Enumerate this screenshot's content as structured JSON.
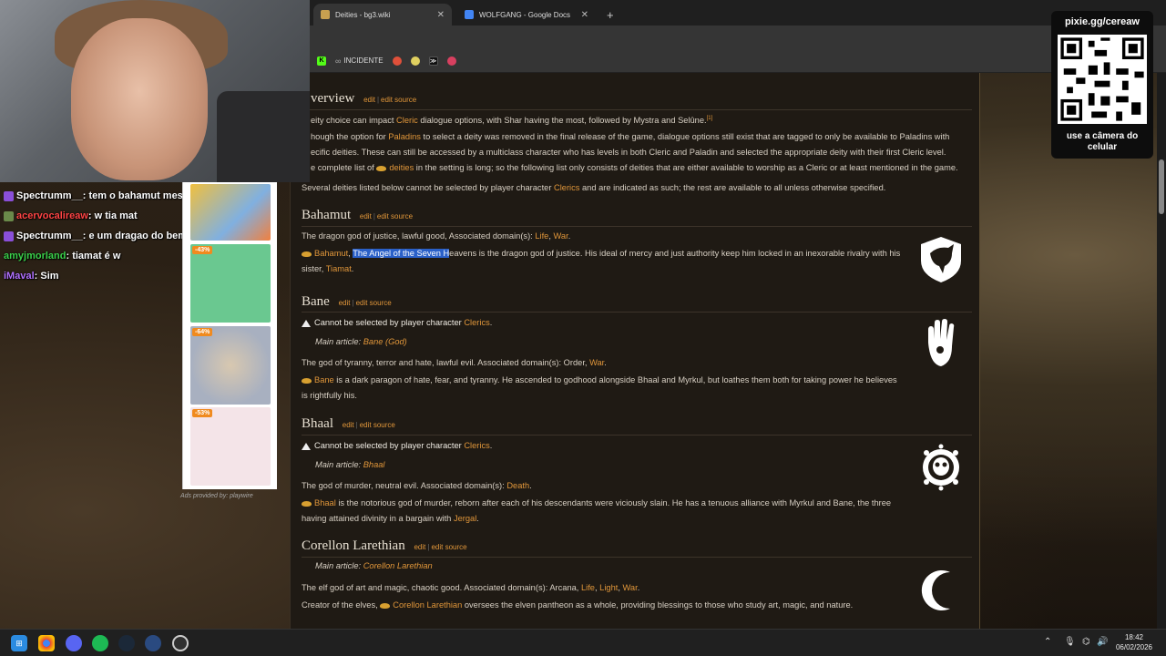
{
  "browser": {
    "tabs": [
      {
        "title": "Deities - bg3.wiki",
        "active": true
      },
      {
        "title": "WOLFGANG - Google Docs",
        "active": false
      }
    ],
    "bookmarks": [
      {
        "label": "",
        "icon": "kick-icon",
        "color": "#53fc18"
      },
      {
        "label": "INCIDENTE",
        "icon": "incidente-icon",
        "color": "#aaaaaa"
      },
      {
        "label": "",
        "icon": "flame-icon",
        "color": "#e0503a"
      },
      {
        "label": "",
        "icon": "eye-icon",
        "color": "#e0d060"
      },
      {
        "label": "",
        "icon": "terminal-icon",
        "color": "#111111"
      },
      {
        "label": "",
        "icon": "badge-icon",
        "color": "#d84060"
      }
    ]
  },
  "chat": [
    {
      "user": "Spectrumm__",
      "message": "tem o bahamut mesmo",
      "user_color": "#ffffff",
      "badge": "#8a4fd8"
    },
    {
      "user": "acervocalireaw",
      "message": "w tia mat",
      "user_color": "#ff4444",
      "badge": "#6a8a4a"
    },
    {
      "user": "Spectrumm__",
      "message": "e um dragao do bem",
      "user_color": "#ffffff",
      "badge": "#8a4fd8"
    },
    {
      "user": "amyjmorland",
      "message": "tiamat é w",
      "user_color": "#3ad04a",
      "badge": ""
    },
    {
      "user": "iMaval",
      "message": "Sim",
      "user_color": "#b070ff",
      "badge": ""
    }
  ],
  "ads": {
    "items": [
      {
        "discount": "",
        "color": "#f0c040"
      },
      {
        "discount": "-43%",
        "color": "#6ac890"
      },
      {
        "discount": "-64%",
        "color": "#c8d0d8"
      },
      {
        "discount": "-53%",
        "color": "#f4e4e8"
      }
    ],
    "caption": "Ads provided by: playwire"
  },
  "wiki": {
    "overview_heading": "verview",
    "edit": "edit",
    "edit_source": "edit source",
    "overview_p1": {
      "a": "eity choice can impact ",
      "link": "Cleric",
      "b": " dialogue options, with Shar having the most, followed by Mystra and Selûne.",
      "ref": "[1]"
    },
    "overview_p2": {
      "a": "hough the option for ",
      "link": "Paladins",
      "b": " to select a deity was removed in the final release of the game, dialogue options still exist that are tagged to only be available to Paladins with",
      "c": "ecific deities. These can still be accessed by a multiclass character who has levels in both Cleric and Paladin and selected the appropriate deity with their first Cleric level."
    },
    "overview_p3": {
      "a": "e complete list of ",
      "link": "deities",
      "b": " in the setting is long; so the following list only consists of deities that are either available to worship as a Cleric or at least mentioned in the game."
    },
    "overview_p4": {
      "a": "Several deities listed below cannot be selected by player character ",
      "link": "Clerics",
      "b": " and are indicated as such; the rest are available to all unless otherwise specified."
    },
    "bahamut": {
      "heading": "Bahamut",
      "desc": {
        "a": "The dragon god of justice, lawful good, Associated domain(s): ",
        "l1": "Life",
        "sep": ", ",
        "l2": "War",
        "end": "."
      },
      "lore": {
        "link": "Bahamut",
        "comma": ", ",
        "hl": "The Angel of the Seven H",
        "b": "eavens is the dragon god of justice. His ideal of mercy and just authority keep him locked in an inexorable rivalry with his",
        "c": "sister, ",
        "l2": "Tiamat",
        "end": "."
      }
    },
    "bane": {
      "heading": "Bane",
      "notice": {
        "a": "Cannot be selected by player character ",
        "link": "Clerics",
        "end": "."
      },
      "main": {
        "a": "Main article: ",
        "link": "Bane (God)"
      },
      "desc": {
        "a": "The god of tyranny, terror and hate, lawful evil. Associated domain(s): Order, ",
        "l1": "War",
        "end": "."
      },
      "lore": {
        "link": "Bane",
        "b": " is a dark paragon of hate, fear, and tyranny. He ascended to godhood alongside Bhaal and Myrkul, but loathes them both for taking power he believes",
        "c": "is rightfully his."
      }
    },
    "bhaal": {
      "heading": "Bhaal",
      "notice": {
        "a": "Cannot be selected by player character ",
        "link": "Clerics",
        "end": "."
      },
      "main": {
        "a": "Main article: ",
        "link": "Bhaal"
      },
      "desc": {
        "a": "The god of murder, neutral evil. Associated domain(s): ",
        "l1": "Death",
        "end": "."
      },
      "lore": {
        "link": "Bhaal",
        "b": " is the notorious god of murder, reborn after each of his descendants were viciously slain. He has a tenuous alliance with Myrkul and Bane, the three",
        "c": "having attained divinity in a bargain with ",
        "l2": "Jergal",
        "end": "."
      }
    },
    "corellon": {
      "heading": "Corellon Larethian",
      "main": {
        "a": "Main article: ",
        "link": "Corellon Larethian"
      },
      "desc": {
        "a": "The elf god of art and magic, chaotic good. Associated domain(s): Arcana, ",
        "l1": "Life",
        "s1": ", ",
        "l2": "Light",
        "s2": ", ",
        "l3": "War",
        "end": "."
      },
      "lore": {
        "a": "Creator of the elves, ",
        "link": "Corellon Larethian",
        "b": " oversees the elven pantheon as a whole, providing blessings to those who study art, magic, and nature."
      }
    }
  },
  "qr": {
    "title": "pixie.gg/cereaw",
    "caption": "use a câmera do celular"
  },
  "taskbar": {
    "icons": [
      "windows-start-icon",
      "chrome-icon",
      "discord-icon",
      "spotify-icon",
      "steam-icon",
      "app-icon",
      "obs-icon"
    ],
    "time": "18:42",
    "date": "06/02/2026"
  }
}
